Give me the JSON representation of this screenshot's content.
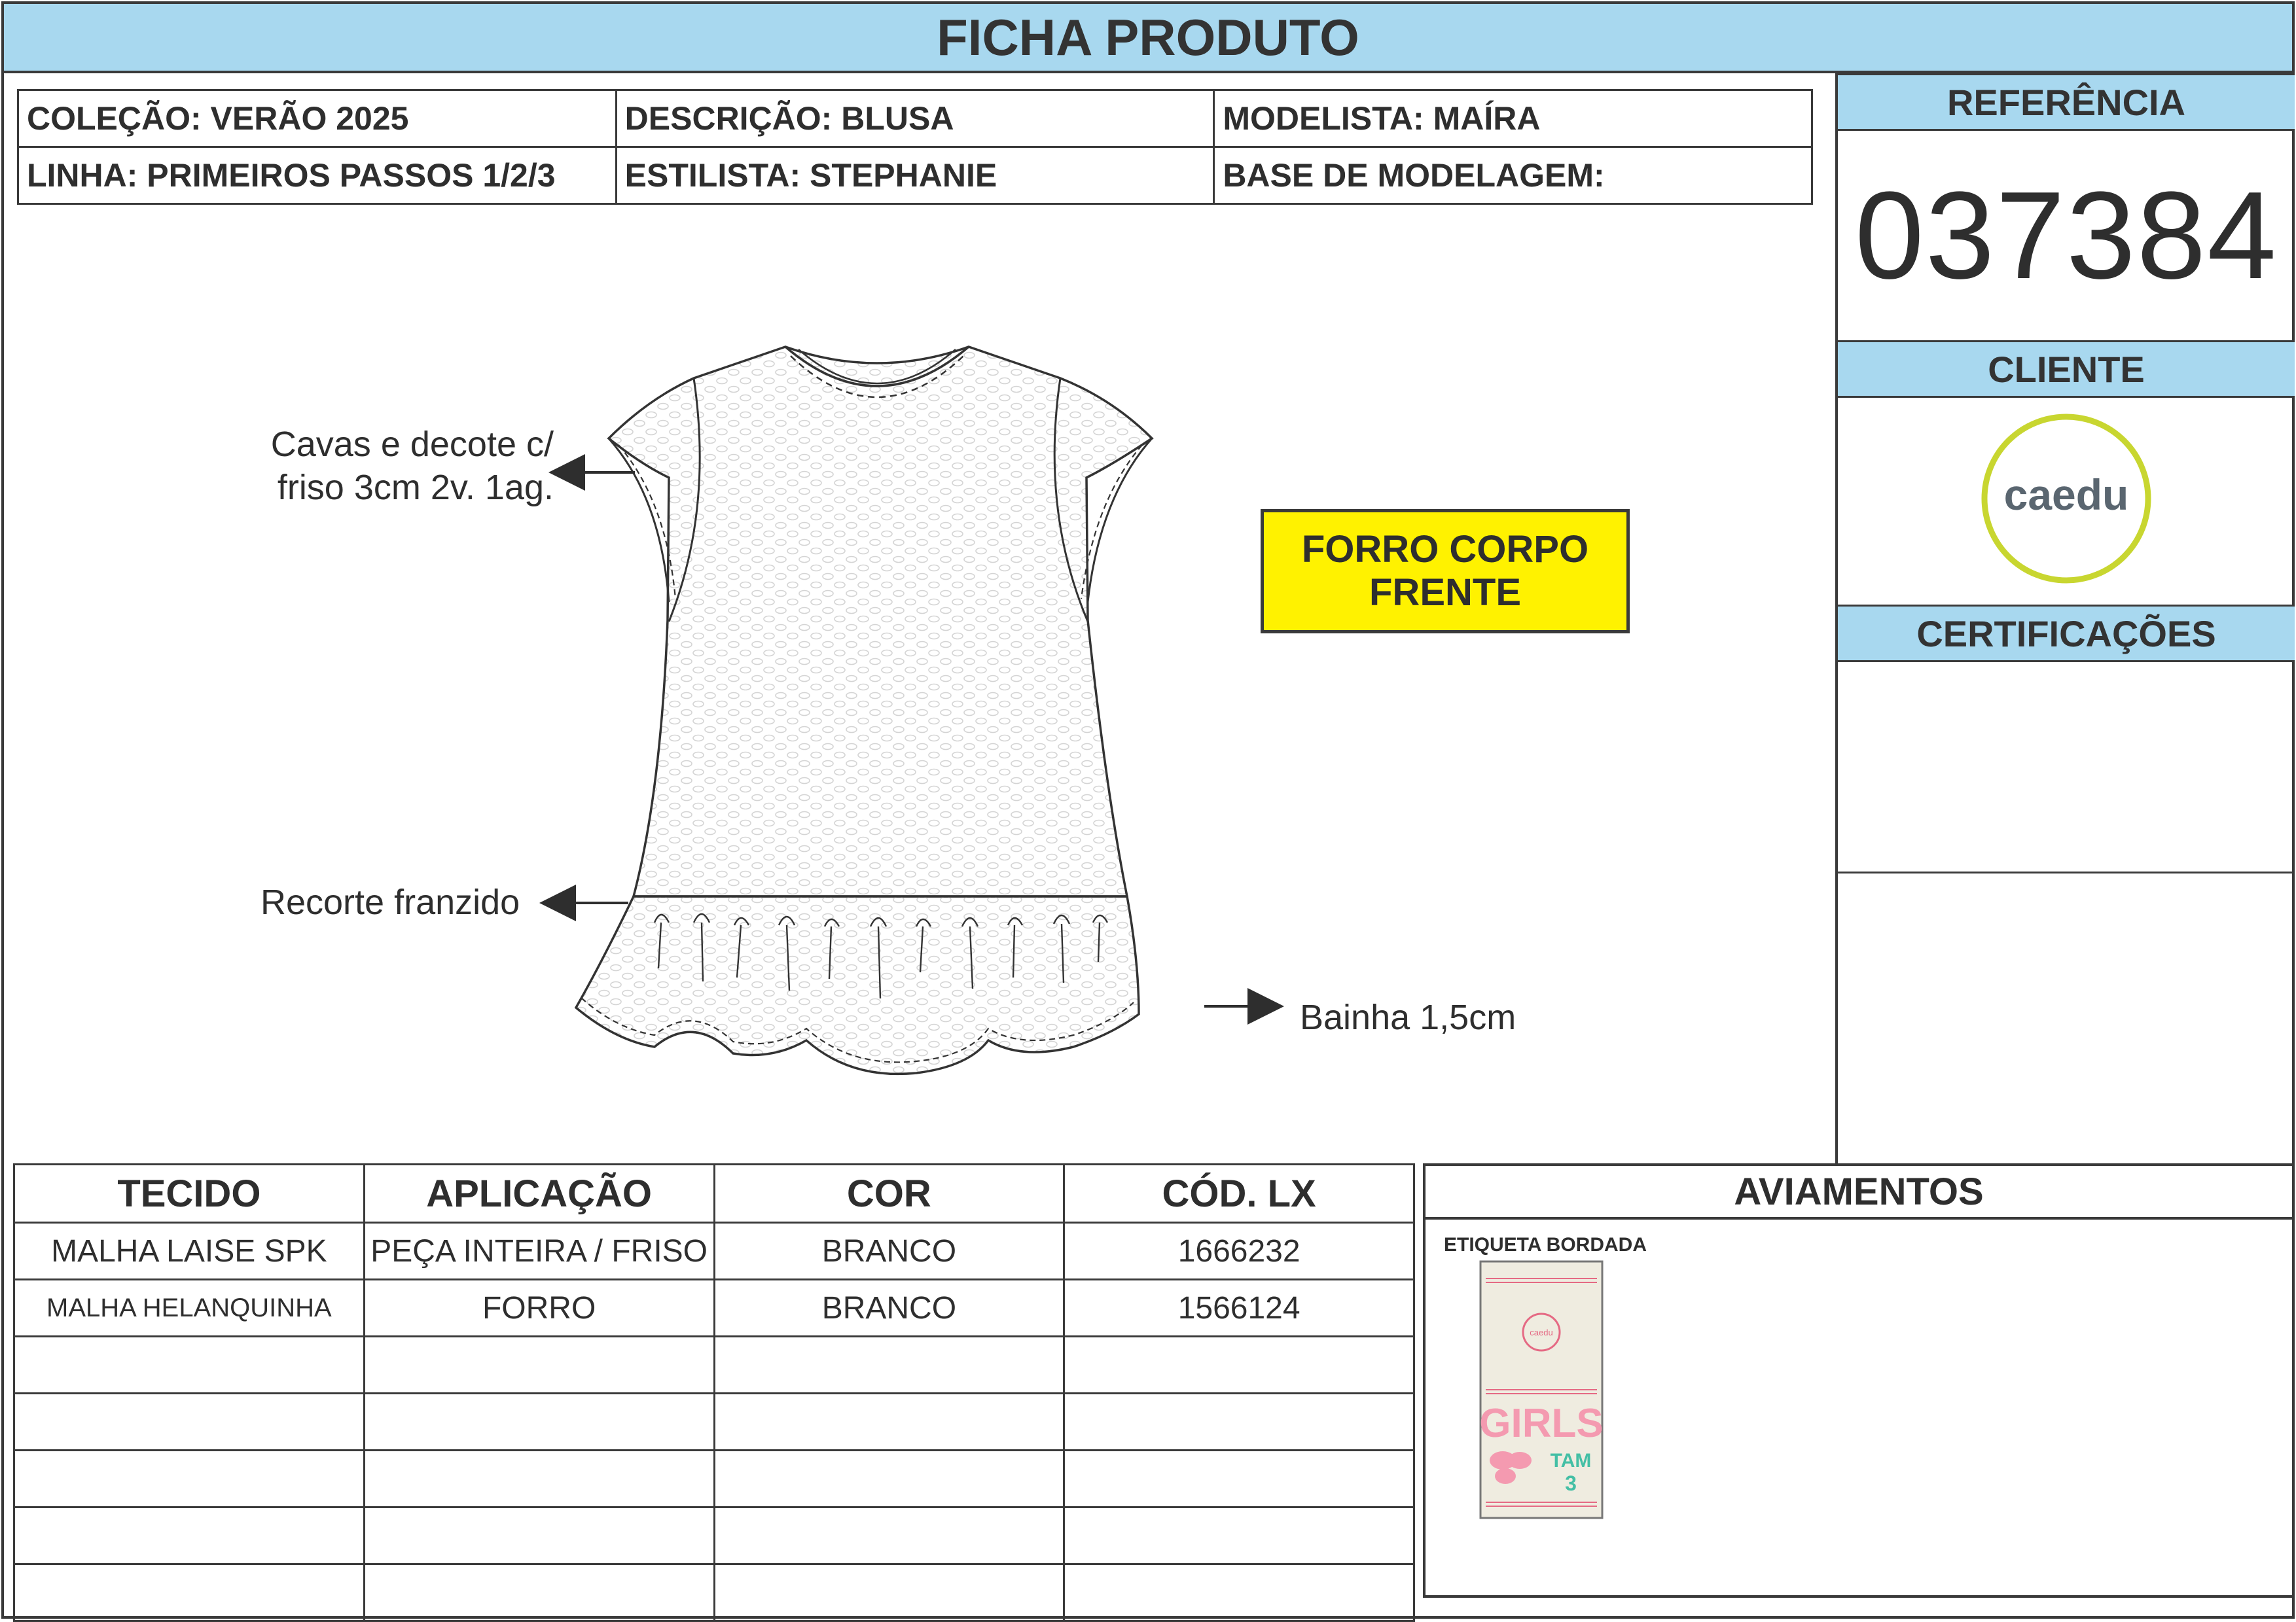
{
  "header": {
    "title": "FICHA PRODUTO"
  },
  "info": {
    "colecao": "COLEÇÃO: VERÃO 2025",
    "descricao": "DESCRIÇÃO: BLUSA",
    "modelista": "MODELISTA: MAÍRA",
    "linha": "LINHA: PRIMEIROS PASSOS 1/2/3",
    "estilista": "ESTILISTA: STEPHANIE",
    "base": "BASE DE MODELAGEM:"
  },
  "side": {
    "referencia_label": "REFERÊNCIA",
    "referencia_value": "037384",
    "cliente_label": "CLIENTE",
    "cliente_logo": "caedu",
    "certificacoes_label": "CERTIFICAÇÕES"
  },
  "callouts": {
    "cavas_line1": "Cavas e decote c/",
    "cavas_line2": "friso 3cm 2v. 1ag.",
    "recorte": "Recorte franzido",
    "bainha": "Bainha 1,5cm",
    "forro_line1": "FORRO CORPO",
    "forro_line2": "FRENTE"
  },
  "fabrics": {
    "headers": [
      "TECIDO",
      "APLICAÇÃO",
      "COR",
      "CÓD. LX"
    ],
    "rows": [
      [
        "MALHA LAISE SPK",
        "PEÇA INTEIRA / FRISO",
        "BRANCO",
        "1666232"
      ],
      [
        "MALHA HELANQUINHA",
        "FORRO",
        "BRANCO",
        "1566124"
      ]
    ]
  },
  "aviamentos": {
    "title": "AVIAMENTOS",
    "item_label": "ETIQUETA BORDADA",
    "label_logo": "caedu",
    "label_girls": "GIRLS",
    "label_tam": "TAM",
    "label_size": "3"
  },
  "colors": {
    "header_blue": "#a8d8ef",
    "badge_yellow": "#fff200",
    "logo_ring": "#c8d630",
    "logo_text": "#5a6670"
  }
}
